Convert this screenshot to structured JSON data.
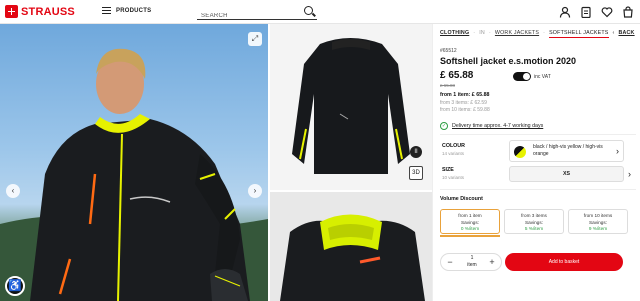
{
  "header": {
    "logo_text": "STRAUSS",
    "menu_label": "PRODUCTS",
    "search_placeholder": "SEARCH"
  },
  "icons": {
    "account": "user-icon",
    "wishlist": "clipboard-icon",
    "favorites": "heart-icon",
    "cart": "bag-icon"
  },
  "gallery": {
    "zoom": "⤢",
    "prev": "‹",
    "next": "›",
    "pause": "II",
    "view360": "3D"
  },
  "breadcrumb": {
    "items": [
      "CLOTHING",
      "IN",
      "WORK JACKETS",
      "SOFTSHELL JACKETS"
    ],
    "back": "BACK"
  },
  "product": {
    "article": "#65512",
    "title": "Softshell jacket e.s.motion 2020",
    "price": "£ 65.88",
    "old_price": "£ 65.88",
    "vat_label": "inc VAT",
    "tier_from1": "from 1 item: £ 65.88",
    "tier_from3": "from 3 items: £ 62.59",
    "tier_from10": "from 10 items: £ 59.88",
    "delivery": "Delivery time approx. 4-7 working days"
  },
  "options": {
    "colour_label": "COLOUR",
    "colour_sub": "14 variants",
    "colour_value": "black / high-vis yellow / high-vis orange",
    "size_label": "SIZE",
    "size_sub": "10 variants",
    "size_value": "XS"
  },
  "volume": {
    "label": "Volume Discount",
    "tiers": [
      {
        "title": "from 1 item",
        "savings": "Savings:",
        "pct": "0 %/item"
      },
      {
        "title": "from 3 items",
        "savings": "Savings:",
        "pct": "5 %/item"
      },
      {
        "title": "from 10 items",
        "savings": "Savings:",
        "pct": "9 %/item"
      }
    ]
  },
  "cart": {
    "qty": "1",
    "qty_unit": "item",
    "add_label": "Add to basket"
  },
  "colors": {
    "brand": "#e30613",
    "hivis": "#e7f200",
    "accent_orange": "#e9a23b",
    "success": "#2e9e44"
  }
}
